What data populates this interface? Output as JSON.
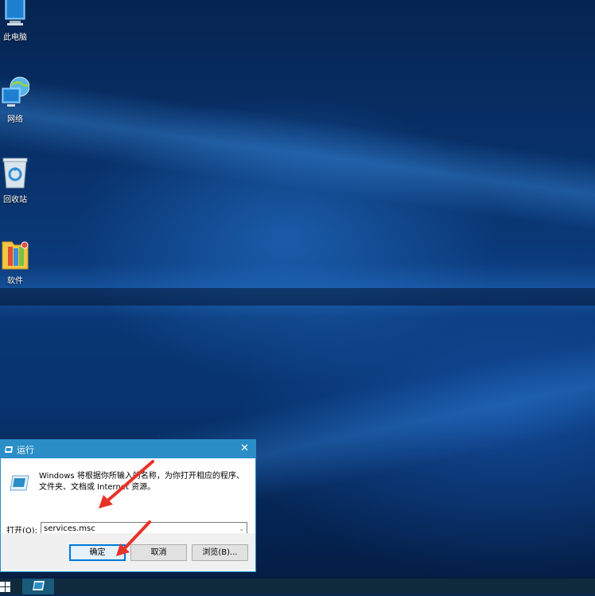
{
  "desktop": {
    "icons": [
      {
        "label": "此电脑",
        "icon": "this-pc-icon"
      },
      {
        "label": "网络",
        "icon": "network-icon"
      },
      {
        "label": "回收站",
        "icon": "recycle-bin-icon"
      },
      {
        "label": "软件",
        "icon": "software-folder-icon"
      }
    ]
  },
  "run_dialog": {
    "title": "运行",
    "close_glyph": "✕",
    "description": "Windows 将根据你所输入的名称，为你打开相应的程序、文件夹、文档或 Internet 资源。",
    "open_label": "打开(O):",
    "open_value": "services.msc",
    "ok_label": "确定",
    "cancel_label": "取消",
    "browse_label": "浏览(B)..."
  },
  "colors": {
    "accent": "#2b8ec7",
    "arrow": "#e8332a",
    "taskbar": "#0f2a3c"
  }
}
